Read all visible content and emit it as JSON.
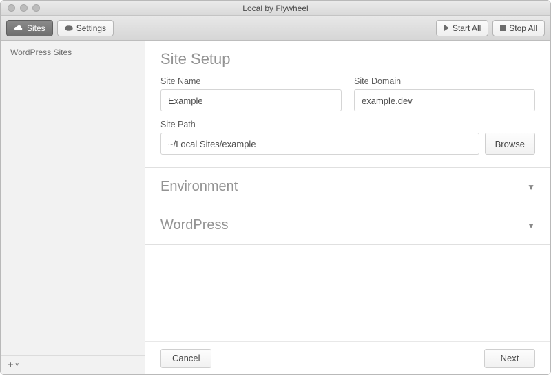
{
  "window": {
    "title": "Local by Flywheel"
  },
  "toolbar": {
    "sites_label": "Sites",
    "settings_label": "Settings",
    "start_all_label": "Start All",
    "stop_all_label": "Stop All"
  },
  "sidebar": {
    "header": "WordPress Sites",
    "add_glyph": "+",
    "add_chevron": "˅"
  },
  "setup": {
    "title": "Site Setup",
    "site_name_label": "Site Name",
    "site_name_value": "Example",
    "site_domain_label": "Site Domain",
    "site_domain_value": "example.dev",
    "site_path_label": "Site Path",
    "site_path_value": "~/Local Sites/example",
    "browse_label": "Browse"
  },
  "accordions": {
    "environment": "Environment",
    "wordpress": "WordPress"
  },
  "footer": {
    "cancel_label": "Cancel",
    "next_label": "Next"
  }
}
